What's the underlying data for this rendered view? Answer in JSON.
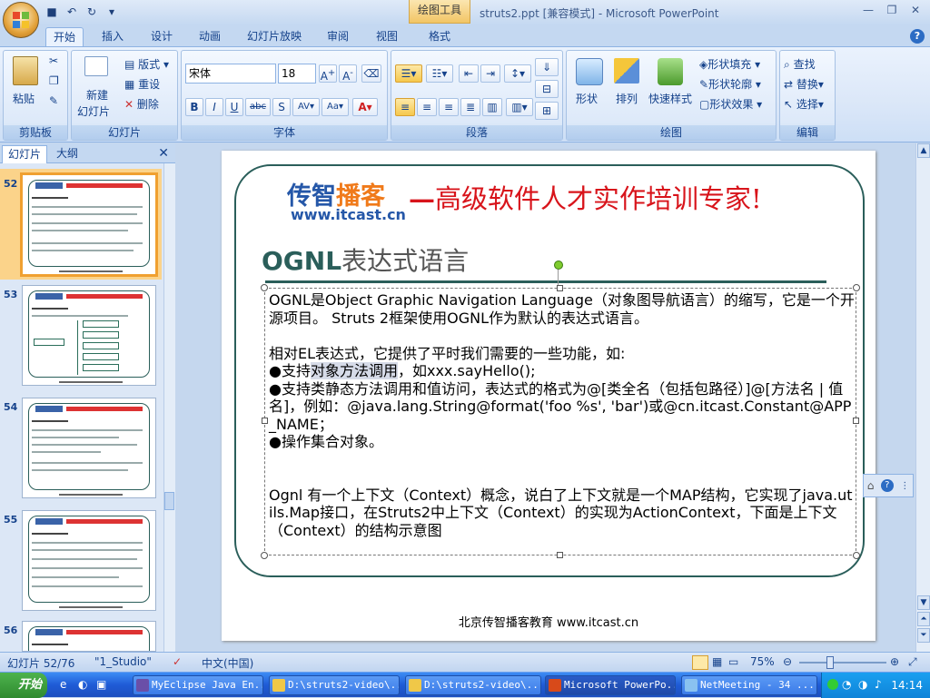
{
  "window": {
    "title": "struts2.ppt [兼容模式] - Microsoft PowerPoint",
    "contextual_tab": "绘图工具"
  },
  "ribbon_tabs": [
    "开始",
    "插入",
    "设计",
    "动画",
    "幻灯片放映",
    "审阅",
    "视图",
    "格式"
  ],
  "ribbon": {
    "clipboard": {
      "label": "剪贴板",
      "paste": "粘贴"
    },
    "slides": {
      "label": "幻灯片",
      "new_slide": "新建",
      "new_slide2": "幻灯片",
      "layout": "版式",
      "reset": "重设",
      "delete": "删除"
    },
    "font": {
      "label": "字体",
      "font_name": "宋体",
      "font_size": "18"
    },
    "paragraph": {
      "label": "段落"
    },
    "drawing": {
      "label": "绘图",
      "shapes": "形状",
      "arrange": "排列",
      "quick_styles": "快速样式",
      "fill": "形状填充",
      "outline": "形状轮廓",
      "effects": "形状效果"
    },
    "editing": {
      "label": "编辑",
      "find": "查找",
      "replace": "替换",
      "select": "选择"
    }
  },
  "panel": {
    "tab_slides": "幻灯片",
    "tab_outline": "大纲",
    "thumbnails": [
      {
        "num": "52",
        "selected": true
      },
      {
        "num": "53"
      },
      {
        "num": "54"
      },
      {
        "num": "55"
      },
      {
        "num": "56"
      }
    ]
  },
  "slide": {
    "logo_main_a": "传智",
    "logo_main_b": "播客",
    "logo_url": "www.itcast.cn",
    "tagline_dash": "—",
    "tagline": "高级软件人才实作培训专家!",
    "title_en": "OGNL",
    "title_cn": "表达式语言",
    "p1": "OGNL是Object Graphic Navigation Language（对象图导航语言）的缩写，它是一个开源项目。 Struts 2框架使用OGNL作为默认的表达式语言。",
    "p2": "相对EL表达式，它提供了平时我们需要的一些功能，如:",
    "b1_pre": "●支持",
    "b1_hl": "对象方法调用",
    "b1_post": "，如xxx.sayHello();",
    "b2": "●支持类静态方法调用和值访问，表达式的格式为@[类全名（包括包路径）]@[方法名 |  值名]，例如：@java.lang.String@format('foo %s', 'bar')或@cn.itcast.Constant@APP_NAME；",
    "b3": "●操作集合对象。",
    "p3": "Ognl 有一个上下文（Context）概念，说白了上下文就是一个MAP结构，它实现了java.utils.Map接口，在Struts2中上下文（Context）的实现为ActionContext，下面是上下文（Context）的结构示意图",
    "footer": "北京传智播客教育 www.itcast.cn"
  },
  "status": {
    "slide_info": "幻灯片 52/76",
    "theme": "\"1_Studio\"",
    "language": "中文(中国)",
    "zoom": "75%"
  },
  "taskbar": {
    "start": "开始",
    "items": [
      "MyEclipse Java En...",
      "D:\\struts2-video\\...",
      "D:\\struts2-video\\...",
      "Microsoft PowerPo...",
      "NetMeeting - 34 ..."
    ],
    "clock": "14:14"
  }
}
